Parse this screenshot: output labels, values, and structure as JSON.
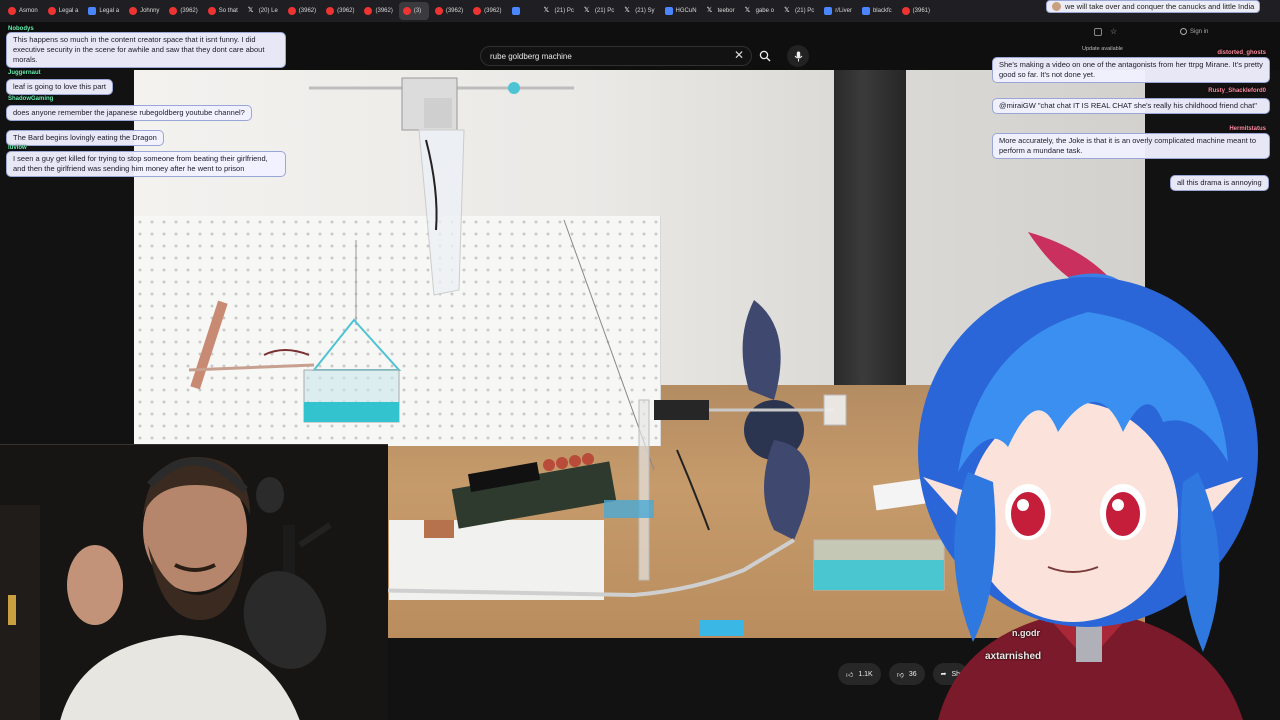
{
  "browser": {
    "tabs": [
      {
        "label": "Asmon",
        "icon": "youtube-icon"
      },
      {
        "label": "Legal a",
        "icon": "youtube-icon"
      },
      {
        "label": "Legal a",
        "icon": "page-icon"
      },
      {
        "label": "Johnny",
        "icon": "youtube-icon"
      },
      {
        "label": "(3962)",
        "icon": "youtube-icon"
      },
      {
        "label": "So that",
        "icon": "youtube-icon"
      },
      {
        "label": "(20) Le",
        "icon": "x-icon"
      },
      {
        "label": "(3962)",
        "icon": "youtube-icon"
      },
      {
        "label": "(3962)",
        "icon": "youtube-icon"
      },
      {
        "label": "(3962)",
        "icon": "youtube-icon"
      },
      {
        "label": "(3)",
        "icon": "youtube-icon",
        "active": true
      },
      {
        "label": "(3962)",
        "icon": "youtube-icon"
      },
      {
        "label": "(3962)",
        "icon": "youtube-icon"
      },
      {
        "label": "",
        "icon": "page-icon"
      },
      {
        "label": "(21) Pc",
        "icon": "x-icon"
      },
      {
        "label": "(21) Pc",
        "icon": "x-icon"
      },
      {
        "label": "(21) Sy",
        "icon": "x-icon"
      },
      {
        "label": "HGCuN",
        "icon": "page-icon"
      },
      {
        "label": "teebor",
        "icon": "x-icon"
      },
      {
        "label": "gabe o",
        "icon": "x-icon"
      },
      {
        "label": "(21) Pc",
        "icon": "x-icon"
      },
      {
        "label": "r/Liver",
        "icon": "page-icon"
      },
      {
        "label": "blackfc",
        "icon": "page-icon"
      },
      {
        "label": "(3961)",
        "icon": "youtube-icon"
      }
    ]
  },
  "youtube": {
    "search_value": "rube goldberg machine",
    "sign_in": "Sign in",
    "update_available": "Update available",
    "likes": "1.1K",
    "dislikes": "36",
    "share": "Sh"
  },
  "chat_left": [
    {
      "user": "Nobodys",
      "text": "This happens so much in the content creator space that it isnt funny. I did executive security in the scene for awhile and saw that they dont care about morals."
    },
    {
      "user": "Juggernaut",
      "text": "leaf is going to love this part"
    },
    {
      "user": "ShadowGaming",
      "text": "does anyone remember the japanese rubegoldberg youtube channel?"
    },
    {
      "user": "",
      "text": "The Bard begins lovingly eating the Dragon"
    },
    {
      "user": "luvlow",
      "text": "I seen a guy get killed for trying to stop someone from beating their girlfriend, and then the girlfriend was sending him money after he went to prison"
    }
  ],
  "chat_right": [
    {
      "user": "distorted_ghosts",
      "text": "She's making a video on one of the antagonists from her ttrpg Mirane. It's pretty good so far. It's not done yet."
    },
    {
      "user": "Rusty_Shackleford0",
      "text": "@miraiGW \"chat chat IT IS REAL CHAT she's really his childhood friend chat\""
    },
    {
      "user": "Hermitstatus",
      "text": "More accurately, the Joke is that it is an overly complicated machine meant to perform a mundane task."
    },
    {
      "user": "",
      "text": "all this drama is annoying"
    }
  ],
  "top_banner": "we will take over and conquer the canucks and little India",
  "overlay_names": [
    "axtarnished",
    "n.godr"
  ],
  "colors": {
    "accent_chat_name": "#6cf0b1",
    "bubble_border": "#9aa7d6",
    "vtuber_hair": "#3a8ff0"
  }
}
